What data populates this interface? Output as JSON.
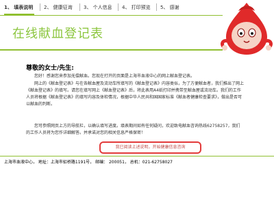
{
  "tabs": [
    {
      "label": "1、 填表说明",
      "active": true
    },
    {
      "label": "2、 健康征询",
      "active": false
    },
    {
      "label": "3、 个人信息",
      "active": false
    },
    {
      "label": "4、 打印预览",
      "active": false
    },
    {
      "label": "5、 感谢",
      "active": false
    }
  ],
  "banner": {
    "title": "在线献血登记表"
  },
  "greeting": {
    "title": "尊敬的女士/先生:"
  },
  "body_lines": [
    "您好！感谢您来参加无偿献血。您现在打开的页面是上海市血液中心的网上献血登记表。",
    "网上的《献血登记表》与在各献血屋及流动车所填写的《献血登记表》内容类似，为了方便献血者，我们推出了网上《献血登记表》的填写。请您在填写网上《献血登记表》后，将此表用A4纸打印并携带至献血屋或流动车。我们的工作人员将根据《献血登记表》的填写内容及体检情况，根据中华人民共和国国家标准《献血者健康检查要求》，做出是否可以献血的判断。",
    "您可参照网页上方的导航栏，以确认填写进度。填表期间如有任何疑问，欢迎致电献血咨询热线62758257，我们的工作人员将为您作详细解答。并承诺对您的相关信息严格保密！"
  ],
  "action_button": {
    "label": "我已阅读上述说明，开始健康信息咨询"
  },
  "footer": {
    "text": "上海市血液中心，  地址：上海市虹桥路1191号， 邮编： 200051， 总机：021-62758027"
  },
  "colors": {
    "accent": "#8cc63f",
    "rule": "#8fbf2f",
    "button_border": "#e23a3a",
    "mascot": "#e02a2a"
  },
  "icons": {
    "mascot": "blood-drop-mascot-icon"
  }
}
